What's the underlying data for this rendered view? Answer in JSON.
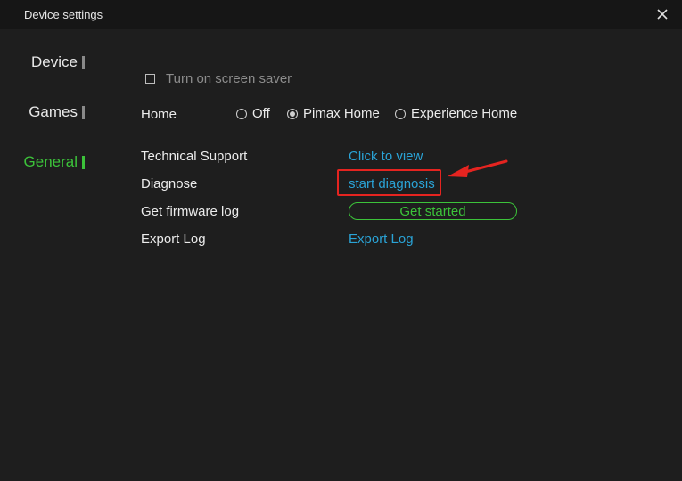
{
  "window": {
    "title": "Device settings"
  },
  "nav": {
    "items": [
      {
        "label": "Device",
        "active": false
      },
      {
        "label": "Games",
        "active": false
      },
      {
        "label": "General",
        "active": true
      }
    ]
  },
  "general": {
    "screen_saver": {
      "label": "Turn on screen saver",
      "checked": false
    },
    "home": {
      "label": "Home",
      "options": [
        {
          "label": "Off",
          "selected": false
        },
        {
          "label": "Pimax Home",
          "selected": true
        },
        {
          "label": "Experience Home",
          "selected": false
        }
      ]
    },
    "technical_support": {
      "label": "Technical Support",
      "action": "Click to view"
    },
    "diagnose": {
      "label": "Diagnose",
      "action": "start diagnosis"
    },
    "firmware_log": {
      "label": "Get firmware log",
      "action": "Get started"
    },
    "export_log": {
      "label": "Export Log",
      "action": "Export Log"
    }
  },
  "colors": {
    "accent": "#3cc33a",
    "link": "#2aa3d6",
    "annotation": "#e52420",
    "background": "#1e1e1e"
  },
  "icons": {
    "close": "close-icon",
    "annotation_arrow": "arrow-icon"
  }
}
